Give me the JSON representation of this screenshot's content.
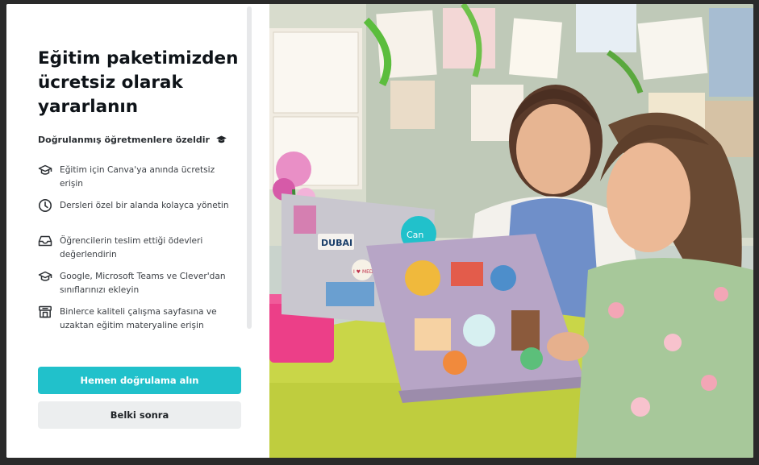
{
  "modal": {
    "title": "Eğitim paketimizden ücretsiz olarak yararlanın",
    "subtitle": "Doğrulanmış öğretmenlere özeldir",
    "features": [
      {
        "icon": "graduation-cap-icon",
        "text": "Eğitim için Canva'ya anında ücretsiz erişin"
      },
      {
        "icon": "clock-icon",
        "text": "Dersleri özel bir alanda kolayca yönetin"
      },
      {
        "icon": "inbox-tray-icon",
        "text": "Öğrencilerin teslim ettiği ödevleri değerlendirin"
      },
      {
        "icon": "graduation-cap-icon",
        "text": "Google, Microsoft Teams ve Clever'dan sınıflarınızı ekleyin"
      },
      {
        "icon": "archive-box-icon",
        "text": "Binlerce kaliteli çalışma sayfasına ve uzaktan eğitim materyaline erişin"
      }
    ],
    "primary_button": "Hemen doğrulama alın",
    "secondary_button": "Belki sonra"
  },
  "photo": {
    "description_icon": "classroom-photo",
    "sticker_texts": [
      "DUBAI",
      "Can",
      "I ♥ MED"
    ]
  },
  "colors": {
    "primary": "#21c1cb",
    "secondary_bg": "#eceeef",
    "title": "#0e1318"
  }
}
